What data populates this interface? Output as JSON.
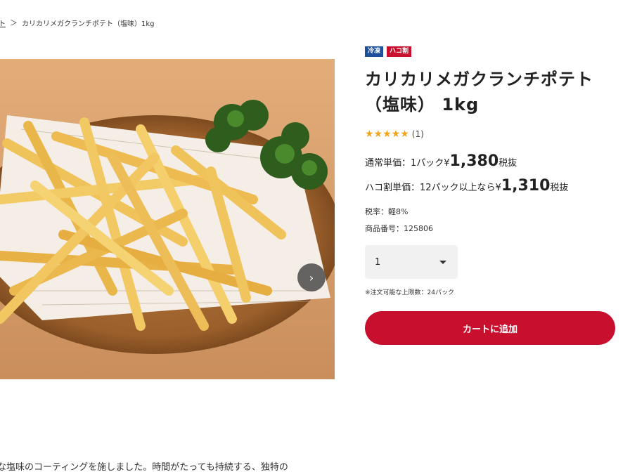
{
  "breadcrumb": {
    "parent": "ト",
    "separator": "＞",
    "current": "カリカリメガクランチポテト（塩味）1kg"
  },
  "gallery": {
    "next_icon": "chevron-right-icon",
    "next_glyph": "›"
  },
  "product": {
    "tags": [
      "冷凍",
      "ハコ割"
    ],
    "title_line1": "カリカリメガクランチポテト",
    "title_line2": "（塩味） 1kg",
    "stars": "★★★★★",
    "rating_count": "(1)",
    "rating_value": 5,
    "regular_price": {
      "prefix": "通常単価：1パック¥",
      "value": "1,380",
      "suffix": "税抜"
    },
    "hako_price": {
      "prefix": "ハコ割単価：12パック以上なら¥",
      "value": "1,310",
      "suffix": "税抜"
    },
    "tax_rate": "税率：軽8%",
    "product_number": "商品番号：125806",
    "quantity": "1",
    "order_note": "※注文可能な上限数：24パック",
    "cart_label": "カートに追加"
  },
  "description": {
    "text": "な塩味のコーティングを施しました。時間がたっても持続する、独特の"
  },
  "colors": {
    "accent_red": "#c8102e",
    "frozen_blue": "#1e4f9c",
    "star": "#f2a516"
  }
}
